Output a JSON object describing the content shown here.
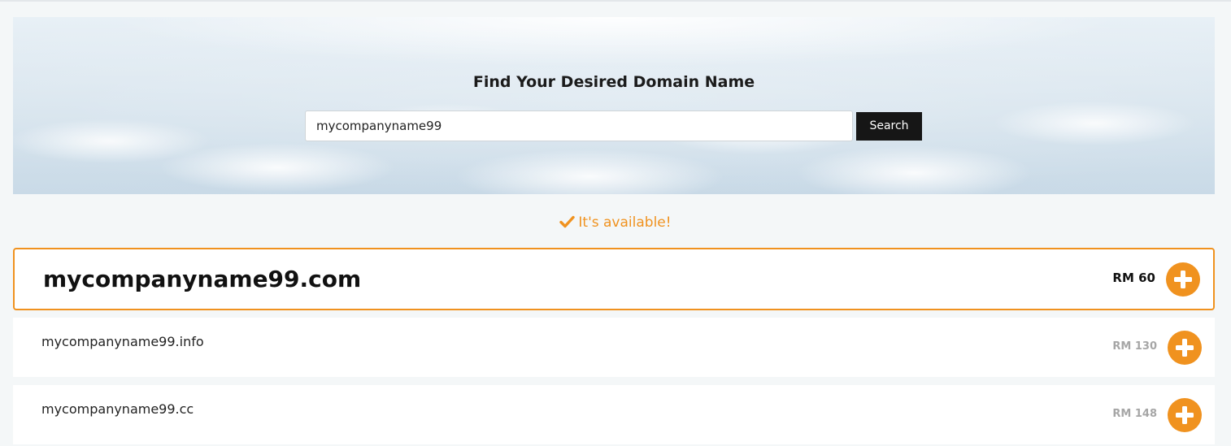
{
  "hero": {
    "title": "Find Your Desired Domain Name",
    "search_value": "mycompanyname99",
    "search_button": "Search"
  },
  "status": {
    "message": "It's available!",
    "icon": "check-icon",
    "color": "#f0921f"
  },
  "results": [
    {
      "domain": "mycompanyname99.com",
      "price": "RM 60",
      "featured": true
    },
    {
      "domain": "mycompanyname99.info",
      "price": "RM 130",
      "featured": false
    },
    {
      "domain": "mycompanyname99.cc",
      "price": "RM 148",
      "featured": false
    }
  ],
  "colors": {
    "accent": "#f0921f",
    "button_dark": "#161616",
    "page_bg": "#f4f7f8"
  }
}
